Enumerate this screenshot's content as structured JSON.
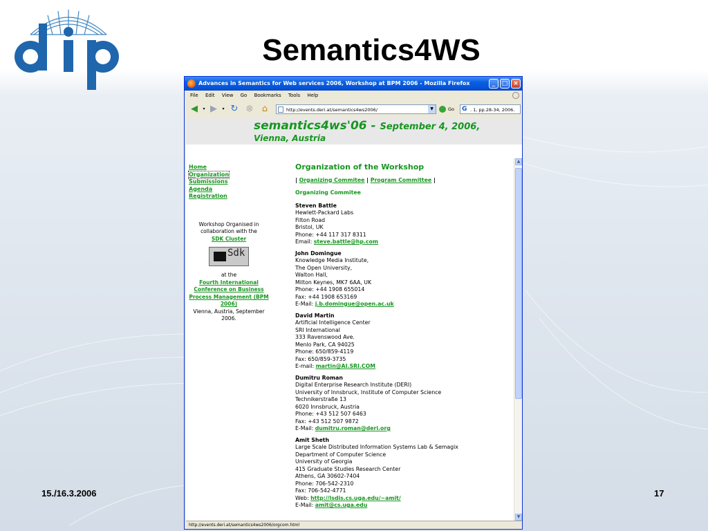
{
  "slide": {
    "title": "Semantics4WS",
    "logo_text": "dip",
    "footer_date": "15./16.3.2006",
    "page_number": "17"
  },
  "browser": {
    "window_title": "Advances in Semantics for Web services 2006, Workshop at BPM 2006 - Mozilla Firefox",
    "menu": [
      "File",
      "Edit",
      "View",
      "Go",
      "Bookmarks",
      "Tools",
      "Help"
    ],
    "url": "http://events.deri.at/semantics4ws2006/",
    "go_label": "Go",
    "search_value": ". 1, pp.28-34, 2006.",
    "status_text": "http://events.deri.at/semantics4ws2006/orgcom.html"
  },
  "page": {
    "banner_line1": "semantics4ws'06 -",
    "banner_date": "September 4, 2006,",
    "banner_line2": "Vienna, Austria",
    "nav": [
      "Home",
      "Organization",
      "Submissions",
      "Agenda",
      "Registration"
    ],
    "organised_text": "Workshop Organised in collaboration with the",
    "sdk_link": "SDK Cluster",
    "sdk_logo_text": "Sdk",
    "at_the": "at the",
    "bpm_link": "Fourth International Conference on Business Process Management (BPM 2006)",
    "venue": "Vienna, Austria, September 2006.",
    "heading": "Organization of the Workshop",
    "tab_links": [
      "Organizing Commitee",
      "Program Committee"
    ],
    "subheading": "Organizing Commitee",
    "people": [
      {
        "name": "Steven Battle",
        "lines": [
          "Hewlett-Packard Labs",
          "Filton Road",
          "Bristol, UK",
          "Phone: +44 117 317 8311"
        ],
        "email_label": "Email:",
        "email": "steve.battle@hp.com"
      },
      {
        "name": "John Domingue",
        "lines": [
          "Knowledge Media Institute,",
          "The Open University,",
          "Walton Hall,",
          "Milton Keynes, MK7 6AA, UK",
          "Phone: +44 1908 655014",
          "Fax: +44 1908 653169"
        ],
        "email_label": "E-Mail:",
        "email": "j.b.domingue@open.ac.uk"
      },
      {
        "name": "David Martin",
        "lines": [
          "Artificial Intelligence Center",
          "SRI International",
          "333 Ravenswood Ave.",
          "Menlo Park, CA 94025",
          "Phone: 650/859-4119",
          "Fax:   650/859-3735"
        ],
        "email_label": "E-mail:",
        "email": "martin@AI.SRI.COM"
      },
      {
        "name": "Dumitru Roman",
        "lines": [
          "Digital Enterprise Research Institute (DERI)",
          "University of Innsbruck, Institute of Computer Science",
          "Technikerstraße 13",
          "6020 Innsbruck, Austria",
          "Phone: +43 512 507 6463",
          "Fax: +43 512 507 9872"
        ],
        "email_label": "E-Mail:",
        "email": "dumitru.roman@deri.org"
      },
      {
        "name": "Amit Sheth",
        "lines": [
          "Large Scale Distributed Information Systems Lab & Semagix",
          "Department of Computer Science",
          "University of Georgia",
          "415 Graduate Studies Research Center",
          "Athens, GA 30602-7404",
          "Phone: 706-542-2310",
          "Fax: 706-542-4771"
        ],
        "web_label": "Web:",
        "web": "http://lsdis.cs.uga.edu/~amit/",
        "email_label": "E-Mail:",
        "email": "amit@cs.uga.edu"
      }
    ]
  }
}
